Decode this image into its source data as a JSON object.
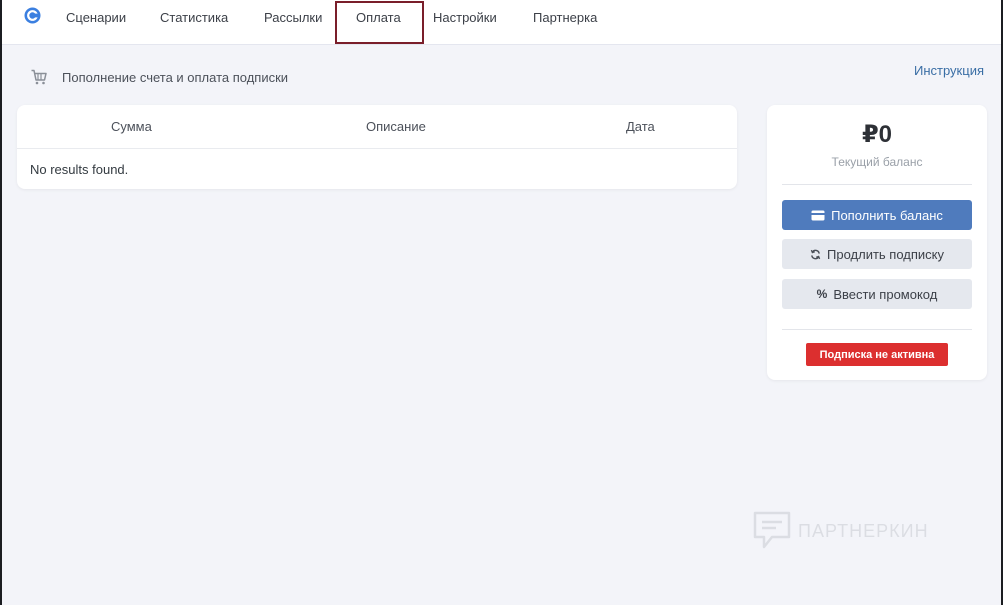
{
  "nav": {
    "items": [
      {
        "label": "Сценарии"
      },
      {
        "label": "Статистика"
      },
      {
        "label": "Рассылки"
      },
      {
        "label": "Оплата"
      },
      {
        "label": "Настройки"
      },
      {
        "label": "Партнерка"
      }
    ],
    "active_index": 3
  },
  "page": {
    "title": "Пополнение счета и оплата подписки",
    "help_link": "Инструкция"
  },
  "table": {
    "columns": [
      "Сумма",
      "Описание",
      "Дата"
    ],
    "empty_text": "No results found."
  },
  "balance": {
    "amount": "₽0",
    "label": "Текущий баланс",
    "topup_label": "Пополнить баланс",
    "extend_label": "Продлить подписку",
    "promo_label": "Ввести промокод",
    "promo_symbol": "%",
    "status_text": "Подписка не активна"
  },
  "colors": {
    "accent": "#4f7bbd",
    "status_inactive": "#dc2f2f",
    "highlight_box": "#7a1e2a"
  },
  "watermark": {
    "text": "ПАРТНЕРКИН"
  },
  "icons": {
    "logo": "logo-icon",
    "cart": "cart-icon",
    "card": "credit-card-icon",
    "refresh": "refresh-icon"
  }
}
